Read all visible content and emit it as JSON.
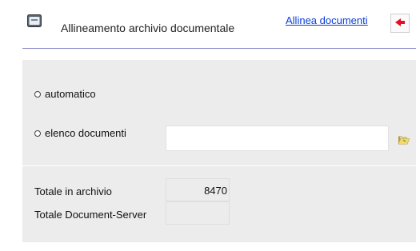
{
  "header": {
    "title": "Allineamento archivio documentale",
    "link_label": "Allinea documenti",
    "app_icon": "archive-icon",
    "back_icon": "red-arrow-left-icon"
  },
  "options": {
    "automatic_label": "automatico",
    "document_list_label": "elenco documenti",
    "document_list_value": "",
    "folder_icon": "folder-open-icon"
  },
  "totals": {
    "archive_label": "Totale in archivio",
    "archive_value": "8470",
    "server_label": "Totale Document-Server",
    "server_value": ""
  },
  "colors": {
    "accent_line": "#8a88c7",
    "link": "#0a3fd6",
    "panel": "#ececec",
    "back_arrow": "#e0102a"
  }
}
